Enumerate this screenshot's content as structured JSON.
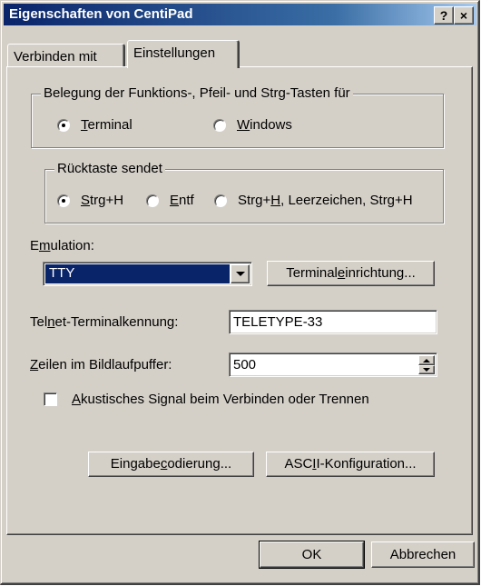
{
  "window": {
    "title": "Eigenschaften von CentiPad",
    "help_button": "?",
    "close_button": "×"
  },
  "tabs": [
    {
      "label": "Verbinden mit",
      "selected": false
    },
    {
      "label": "Einstellungen",
      "selected": true
    }
  ],
  "keys_group": {
    "legend": "Belegung der Funktions-, Pfeil- und Strg-Tasten für",
    "options": [
      {
        "prefix": "",
        "hotkey": "T",
        "rest": "erminal",
        "selected": true
      },
      {
        "prefix": "",
        "hotkey": "W",
        "rest": "indows",
        "selected": false
      }
    ]
  },
  "backspace_group": {
    "legend": "Rücktaste sendet",
    "options": [
      {
        "prefix": "",
        "hotkey": "S",
        "rest": "trg+H",
        "selected": true
      },
      {
        "prefix": "",
        "hotkey": "E",
        "rest": "ntf",
        "selected": false
      },
      {
        "prefix": "Strg+",
        "hotkey": "H",
        "rest": ", Leerzeichen, Strg+H",
        "selected": false
      }
    ]
  },
  "emulation": {
    "label_prefix": "E",
    "label_hotkey": "m",
    "label_rest": "ulation:",
    "value": "TTY",
    "terminal_setup_prefix": "Terminal",
    "terminal_setup_hotkey": "e",
    "terminal_setup_rest": "inrichtung..."
  },
  "telnet": {
    "label_prefix": "Tel",
    "label_hotkey": "n",
    "label_rest": "et-Terminalkennung:",
    "value": "TELETYPE-33"
  },
  "scrollback": {
    "label_prefix": "",
    "label_hotkey": "Z",
    "label_rest": "eilen im Bildlaufpuffer:",
    "value": "500"
  },
  "beep": {
    "hotkey": "A",
    "rest": "kustisches Signal beim Verbinden oder Trennen",
    "checked": false
  },
  "buttons": {
    "input_coding_prefix": "Eingabe",
    "input_coding_hotkey": "c",
    "input_coding_rest": "odierung...",
    "ascii_prefix": "ASC",
    "ascii_hotkey": "I",
    "ascii_rest": "I-Konfiguration...",
    "ok": "OK",
    "cancel": "Abbrechen"
  },
  "colors": {
    "face": "#d4d0c8",
    "title_start": "#0a246a",
    "selection": "#0a246a"
  }
}
